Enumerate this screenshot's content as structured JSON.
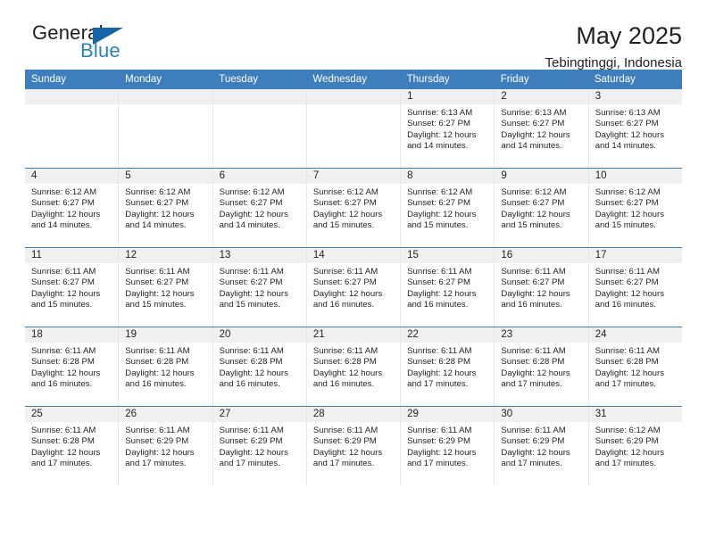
{
  "brand": {
    "word1": "General",
    "word2": "Blue",
    "triangle_color": "#1464aa",
    "blue_text_color": "#2c7fc3"
  },
  "header": {
    "title": "May 2025",
    "subtitle": "Tebingtinggi, Indonesia"
  },
  "theme": {
    "header_blue": "#3e7ebd",
    "daynum_gray": "#f0f0f0",
    "text": "#231f20"
  },
  "calendar": {
    "weekday_headers": [
      "Sunday",
      "Monday",
      "Tuesday",
      "Wednesday",
      "Thursday",
      "Friday",
      "Saturday"
    ],
    "weeks": [
      [
        {
          "day": "",
          "sunrise": "",
          "sunset": "",
          "daylight1": "",
          "daylight2": ""
        },
        {
          "day": "",
          "sunrise": "",
          "sunset": "",
          "daylight1": "",
          "daylight2": ""
        },
        {
          "day": "",
          "sunrise": "",
          "sunset": "",
          "daylight1": "",
          "daylight2": ""
        },
        {
          "day": "",
          "sunrise": "",
          "sunset": "",
          "daylight1": "",
          "daylight2": ""
        },
        {
          "day": "1",
          "sunrise": "Sunrise: 6:13 AM",
          "sunset": "Sunset: 6:27 PM",
          "daylight1": "Daylight: 12 hours",
          "daylight2": "and 14 minutes."
        },
        {
          "day": "2",
          "sunrise": "Sunrise: 6:13 AM",
          "sunset": "Sunset: 6:27 PM",
          "daylight1": "Daylight: 12 hours",
          "daylight2": "and 14 minutes."
        },
        {
          "day": "3",
          "sunrise": "Sunrise: 6:13 AM",
          "sunset": "Sunset: 6:27 PM",
          "daylight1": "Daylight: 12 hours",
          "daylight2": "and 14 minutes."
        }
      ],
      [
        {
          "day": "4",
          "sunrise": "Sunrise: 6:12 AM",
          "sunset": "Sunset: 6:27 PM",
          "daylight1": "Daylight: 12 hours",
          "daylight2": "and 14 minutes."
        },
        {
          "day": "5",
          "sunrise": "Sunrise: 6:12 AM",
          "sunset": "Sunset: 6:27 PM",
          "daylight1": "Daylight: 12 hours",
          "daylight2": "and 14 minutes."
        },
        {
          "day": "6",
          "sunrise": "Sunrise: 6:12 AM",
          "sunset": "Sunset: 6:27 PM",
          "daylight1": "Daylight: 12 hours",
          "daylight2": "and 14 minutes."
        },
        {
          "day": "7",
          "sunrise": "Sunrise: 6:12 AM",
          "sunset": "Sunset: 6:27 PM",
          "daylight1": "Daylight: 12 hours",
          "daylight2": "and 15 minutes."
        },
        {
          "day": "8",
          "sunrise": "Sunrise: 6:12 AM",
          "sunset": "Sunset: 6:27 PM",
          "daylight1": "Daylight: 12 hours",
          "daylight2": "and 15 minutes."
        },
        {
          "day": "9",
          "sunrise": "Sunrise: 6:12 AM",
          "sunset": "Sunset: 6:27 PM",
          "daylight1": "Daylight: 12 hours",
          "daylight2": "and 15 minutes."
        },
        {
          "day": "10",
          "sunrise": "Sunrise: 6:12 AM",
          "sunset": "Sunset: 6:27 PM",
          "daylight1": "Daylight: 12 hours",
          "daylight2": "and 15 minutes."
        }
      ],
      [
        {
          "day": "11",
          "sunrise": "Sunrise: 6:11 AM",
          "sunset": "Sunset: 6:27 PM",
          "daylight1": "Daylight: 12 hours",
          "daylight2": "and 15 minutes."
        },
        {
          "day": "12",
          "sunrise": "Sunrise: 6:11 AM",
          "sunset": "Sunset: 6:27 PM",
          "daylight1": "Daylight: 12 hours",
          "daylight2": "and 15 minutes."
        },
        {
          "day": "13",
          "sunrise": "Sunrise: 6:11 AM",
          "sunset": "Sunset: 6:27 PM",
          "daylight1": "Daylight: 12 hours",
          "daylight2": "and 15 minutes."
        },
        {
          "day": "14",
          "sunrise": "Sunrise: 6:11 AM",
          "sunset": "Sunset: 6:27 PM",
          "daylight1": "Daylight: 12 hours",
          "daylight2": "and 16 minutes."
        },
        {
          "day": "15",
          "sunrise": "Sunrise: 6:11 AM",
          "sunset": "Sunset: 6:27 PM",
          "daylight1": "Daylight: 12 hours",
          "daylight2": "and 16 minutes."
        },
        {
          "day": "16",
          "sunrise": "Sunrise: 6:11 AM",
          "sunset": "Sunset: 6:27 PM",
          "daylight1": "Daylight: 12 hours",
          "daylight2": "and 16 minutes."
        },
        {
          "day": "17",
          "sunrise": "Sunrise: 6:11 AM",
          "sunset": "Sunset: 6:27 PM",
          "daylight1": "Daylight: 12 hours",
          "daylight2": "and 16 minutes."
        }
      ],
      [
        {
          "day": "18",
          "sunrise": "Sunrise: 6:11 AM",
          "sunset": "Sunset: 6:28 PM",
          "daylight1": "Daylight: 12 hours",
          "daylight2": "and 16 minutes."
        },
        {
          "day": "19",
          "sunrise": "Sunrise: 6:11 AM",
          "sunset": "Sunset: 6:28 PM",
          "daylight1": "Daylight: 12 hours",
          "daylight2": "and 16 minutes."
        },
        {
          "day": "20",
          "sunrise": "Sunrise: 6:11 AM",
          "sunset": "Sunset: 6:28 PM",
          "daylight1": "Daylight: 12 hours",
          "daylight2": "and 16 minutes."
        },
        {
          "day": "21",
          "sunrise": "Sunrise: 6:11 AM",
          "sunset": "Sunset: 6:28 PM",
          "daylight1": "Daylight: 12 hours",
          "daylight2": "and 16 minutes."
        },
        {
          "day": "22",
          "sunrise": "Sunrise: 6:11 AM",
          "sunset": "Sunset: 6:28 PM",
          "daylight1": "Daylight: 12 hours",
          "daylight2": "and 17 minutes."
        },
        {
          "day": "23",
          "sunrise": "Sunrise: 6:11 AM",
          "sunset": "Sunset: 6:28 PM",
          "daylight1": "Daylight: 12 hours",
          "daylight2": "and 17 minutes."
        },
        {
          "day": "24",
          "sunrise": "Sunrise: 6:11 AM",
          "sunset": "Sunset: 6:28 PM",
          "daylight1": "Daylight: 12 hours",
          "daylight2": "and 17 minutes."
        }
      ],
      [
        {
          "day": "25",
          "sunrise": "Sunrise: 6:11 AM",
          "sunset": "Sunset: 6:28 PM",
          "daylight1": "Daylight: 12 hours",
          "daylight2": "and 17 minutes."
        },
        {
          "day": "26",
          "sunrise": "Sunrise: 6:11 AM",
          "sunset": "Sunset: 6:29 PM",
          "daylight1": "Daylight: 12 hours",
          "daylight2": "and 17 minutes."
        },
        {
          "day": "27",
          "sunrise": "Sunrise: 6:11 AM",
          "sunset": "Sunset: 6:29 PM",
          "daylight1": "Daylight: 12 hours",
          "daylight2": "and 17 minutes."
        },
        {
          "day": "28",
          "sunrise": "Sunrise: 6:11 AM",
          "sunset": "Sunset: 6:29 PM",
          "daylight1": "Daylight: 12 hours",
          "daylight2": "and 17 minutes."
        },
        {
          "day": "29",
          "sunrise": "Sunrise: 6:11 AM",
          "sunset": "Sunset: 6:29 PM",
          "daylight1": "Daylight: 12 hours",
          "daylight2": "and 17 minutes."
        },
        {
          "day": "30",
          "sunrise": "Sunrise: 6:11 AM",
          "sunset": "Sunset: 6:29 PM",
          "daylight1": "Daylight: 12 hours",
          "daylight2": "and 17 minutes."
        },
        {
          "day": "31",
          "sunrise": "Sunrise: 6:12 AM",
          "sunset": "Sunset: 6:29 PM",
          "daylight1": "Daylight: 12 hours",
          "daylight2": "and 17 minutes."
        }
      ]
    ]
  }
}
